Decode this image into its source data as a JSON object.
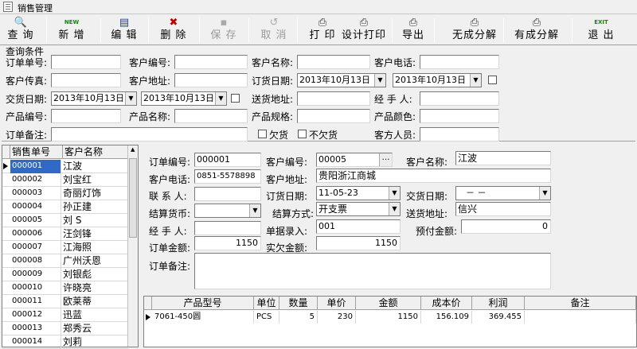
{
  "window": {
    "title": "销售管理"
  },
  "toolbar": [
    {
      "label": "查 询",
      "icon": "🔍",
      "name": "query-button",
      "disabled": false
    },
    {
      "label": "新 增",
      "icon": "NEW",
      "name": "add-button",
      "disabled": false
    },
    {
      "label": "编 辑",
      "icon": "▤",
      "name": "edit-button",
      "disabled": false
    },
    {
      "label": "删 除",
      "icon": "✖",
      "name": "delete-button",
      "disabled": false
    },
    {
      "label": "保 存",
      "icon": "▪",
      "name": "save-button",
      "disabled": true
    },
    {
      "label": "取 消",
      "icon": "↺",
      "name": "cancel-button",
      "disabled": true
    },
    {
      "label": "打 印",
      "icon": "⎙",
      "name": "print-button",
      "disabled": false
    },
    {
      "label": "设计打印",
      "icon": "⎙",
      "name": "design-print-button",
      "disabled": false
    },
    {
      "label": "导出",
      "icon": "⎙",
      "name": "export-button",
      "disabled": false
    },
    {
      "label": "无成分解",
      "icon": "⎙",
      "name": "no-cost-split-button",
      "disabled": false
    },
    {
      "label": "有成分解",
      "icon": "⎙",
      "name": "with-cost-split-button",
      "disabled": false
    },
    {
      "label": "退 出",
      "icon": "EXIT",
      "name": "exit-button",
      "disabled": false
    }
  ],
  "query": {
    "group_title": "查询条件",
    "order_no_label": "订单单号:",
    "customer_no_label": "客户编号:",
    "customer_name_label": "客户名称:",
    "customer_phone_label": "客户电话:",
    "customer_fax_label": "客户传真:",
    "customer_address_label": "客户地址:",
    "order_date_label": "订货日期:",
    "order_date_from": "2013年10月13日",
    "order_date_to": "2013年10月13日",
    "delivery_date_label": "交货日期:",
    "delivery_date_from": "2013年10月13日",
    "delivery_date_to": "2013年10月13日",
    "delivery_address_label": "送货地址:",
    "handler_label": "经 手 人:",
    "product_no_label": "产品编号:",
    "product_name_label": "产品名称:",
    "product_spec_label": "产品规格:",
    "product_color_label": "产品颜色:",
    "remark_label": "订单备注:",
    "owing_label": "欠货",
    "not_owing_label": "不欠货",
    "customer_staff_label": "客方人员:"
  },
  "list": {
    "headers": [
      "销售单号",
      "客户名称"
    ],
    "rows": [
      {
        "id": "000001",
        "name": "江波",
        "selected": true
      },
      {
        "id": "000002",
        "name": "刘宝红"
      },
      {
        "id": "000003",
        "name": "奇丽灯饰"
      },
      {
        "id": "000004",
        "name": "孙正建"
      },
      {
        "id": "000005",
        "name": "刘 S"
      },
      {
        "id": "000006",
        "name": "汪剑锋"
      },
      {
        "id": "000007",
        "name": "江海照"
      },
      {
        "id": "000008",
        "name": "广州沃恩"
      },
      {
        "id": "000009",
        "name": "刘银彪"
      },
      {
        "id": "000010",
        "name": "许晓亮"
      },
      {
        "id": "000011",
        "name": "欧莱蒂"
      },
      {
        "id": "000012",
        "name": "迅蓝"
      },
      {
        "id": "000013",
        "name": "郑秀云"
      },
      {
        "id": "000014",
        "name": "刘莉"
      }
    ]
  },
  "detail": {
    "order_no_label": "订单编号:",
    "order_no": "000001",
    "customer_no_label": "客户编号:",
    "customer_no": "00005",
    "customer_name_label": "客户名称:",
    "customer_name": "江波",
    "customer_phone_label": "客户电话:",
    "customer_phone": "0851-5578898",
    "customer_address_label": "客户地址:",
    "customer_address": "贵阳浙江商城",
    "contact_label": "联 系 人:",
    "contact": "",
    "order_date_label": "订货日期:",
    "order_date": "11-05-23",
    "delivery_date_label": "交货日期:",
    "delivery_date": "－ －",
    "currency_label": "结算货币:",
    "currency": "",
    "payment_label": "结算方式:",
    "payment": "开支票",
    "delivery_address_label": "送货地址:",
    "delivery_address": "信兴",
    "handler_label": "经 手 人:",
    "handler": "",
    "doc_entry_label": "单据录入:",
    "doc_entry": "001",
    "prepaid_label": "预付金额:",
    "prepaid": "0",
    "amount_label": "订单金额:",
    "amount": "1150",
    "owed_label": "实欠金额:",
    "owed": "1150",
    "remark_label": "订单备注:",
    "remark": ""
  },
  "grid": {
    "headers": [
      "产品型号",
      "单位",
      "数量",
      "单价",
      "金额",
      "成本价",
      "利润",
      "备注"
    ],
    "rows": [
      [
        "7061-450圆",
        "PCS",
        "5",
        "230",
        "1150",
        "156.109",
        "369.455",
        ""
      ]
    ]
  }
}
